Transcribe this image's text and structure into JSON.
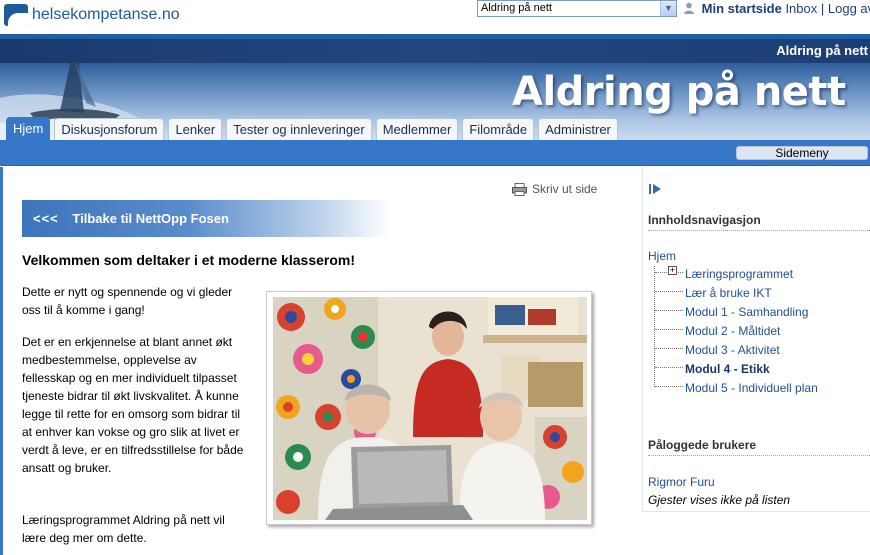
{
  "topbar": {
    "logo_text": "helsekompetanse.no",
    "site_select_value": "Aldring på nett",
    "user_links": {
      "my_start": "Min startside",
      "inbox": "Inbox",
      "separator": "|",
      "logout": "Logg av"
    }
  },
  "banner": {
    "small_title": "Aldring på nett",
    "big_title": "Aldring på nett"
  },
  "tabs": [
    {
      "label": "Hjem",
      "active": true
    },
    {
      "label": "Diskusjonsforum",
      "active": false
    },
    {
      "label": "Lenker",
      "active": false
    },
    {
      "label": "Tester og innleveringer",
      "active": false
    },
    {
      "label": "Medlemmer",
      "active": false
    },
    {
      "label": "Filområde",
      "active": false
    },
    {
      "label": "Administrer",
      "active": false
    }
  ],
  "navbar": {
    "side_menu_label": "Sidemeny"
  },
  "main": {
    "print_label": "Skriv ut side",
    "back_chevrons": "<<<",
    "back_label": "Tilbake til  NettOpp Fosen",
    "welcome_heading": "Velkommen som deltaker i et moderne klasserom!",
    "paragraphs": [
      "Dette er nytt og spennende og vi gleder oss til å komme i gang!",
      "Det er en erkjennelse at blant annet økt medbestemmelse, opplevelse av fellesskap og en mer individuelt tilpasset tjeneste bidrar til økt livskvalitet. Å kunne legge til rette for en omsorg som bidrar til at enhver kan vokse og gro slik at livet er verdt å leve, er en tilfredsstillelse for både ansatt og bruker.",
      "Læringsprogrammet Aldring på nett vil lære deg mer om dette."
    ]
  },
  "sidebar": {
    "content_nav_heading": "Innholdsnavigasjon",
    "tree_root": "Hjem",
    "tree_items": [
      {
        "label": "Læringsprogrammet",
        "current": false
      },
      {
        "label": "Lær å bruke IKT",
        "current": false
      },
      {
        "label": "Modul 1 - Samhandling",
        "current": false
      },
      {
        "label": "Modul 2 - Måltidet",
        "current": false
      },
      {
        "label": "Modul 3 - Aktivitet",
        "current": false
      },
      {
        "label": "Modul 4 - Etikk",
        "current": true
      },
      {
        "label": "Modul 5 - Individuell plan",
        "current": false
      }
    ],
    "online_heading": "Påloggede brukere",
    "online_users": [
      "Rigmor Furu"
    ],
    "guest_note": "Gjester vises ikke på listen"
  },
  "colors": {
    "accent_blue": "#3777c7",
    "link_blue": "#1f4f95",
    "banner_dark": "#193b72"
  }
}
